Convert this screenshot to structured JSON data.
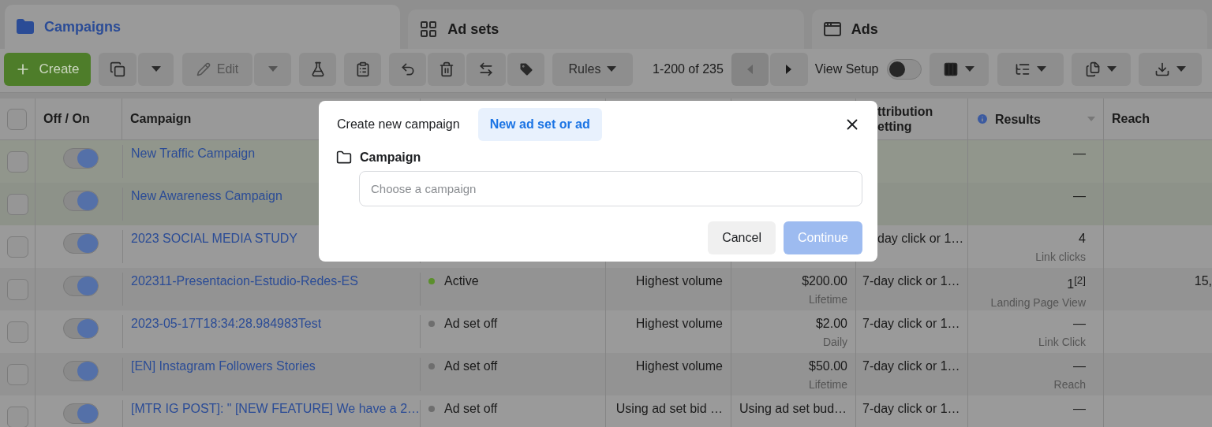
{
  "tabs": [
    {
      "label": "Campaigns",
      "selected": true
    },
    {
      "label": "Ad sets",
      "selected": false
    },
    {
      "label": "Ads",
      "selected": false
    }
  ],
  "toolbar": {
    "create": "Create",
    "edit": "Edit",
    "rules": "Rules",
    "pagination": "1-200 of 235",
    "view_setup": {
      "label": "View Setup",
      "on": false
    }
  },
  "table": {
    "select_all": {
      "checked": false
    },
    "columns": [
      "Off / On",
      "Campaign",
      "ttribution etting",
      "Results",
      "Reach"
    ],
    "rows": [
      {
        "checked": false,
        "on": true,
        "highlighted": true,
        "name": "New Traffic Campaign",
        "results": "—"
      },
      {
        "checked": false,
        "on": true,
        "highlighted": true,
        "name": "New Awareness Campaign",
        "results": "—"
      },
      {
        "checked": false,
        "on": true,
        "highlighted": false,
        "under_dialog": true,
        "name": "2023 SOCIAL MEDIA STUDY",
        "attribution": "day click or 1…",
        "results": "4",
        "result_type": "Link clicks"
      },
      {
        "checked": false,
        "on": true,
        "highlighted": false,
        "name": "202311-Presentacion-Estudio-Redes-ES",
        "delivery": {
          "label": "Active",
          "color": "#5b8f2c"
        },
        "bid": "Highest volume",
        "budget": "$200.00",
        "budget_period": "Lifetime",
        "attribution": "7-day click or 1…",
        "results": "1$^{[2]}$",
        "result_type": "Landing Page View",
        "reach": "15,"
      },
      {
        "checked": false,
        "on": true,
        "highlighted": false,
        "name": "2023-05-17T18:34:28.984983Test",
        "delivery": {
          "label": "Ad set off",
          "color": "#6e6e6e"
        },
        "bid": "Highest volume",
        "budget": "$2.00",
        "budget_period": "Daily",
        "attribution": "7-day click or 1…",
        "results": "—",
        "result_type": "Link Click"
      },
      {
        "checked": false,
        "on": true,
        "highlighted": false,
        "name": "[EN] Instagram Followers Stories",
        "delivery": {
          "label": "Ad set off",
          "color": "#6e6e6e"
        },
        "bid": "Highest volume",
        "budget": "$50.00",
        "budget_period": "Lifetime",
        "attribution": "7-day click or 1…",
        "results": "—",
        "result_type": "Reach"
      },
      {
        "checked": false,
        "on": true,
        "highlighted": false,
        "name": "[MTR IG POST]: \" [NEW FEATURE]  We have a 2…",
        "delivery": {
          "label": "Ad set off",
          "color": "#6e6e6e"
        },
        "bid": "Using ad set bid …",
        "budget": "Using ad set bud…",
        "attribution": "7-day click or 1…",
        "results": "—"
      }
    ]
  },
  "dialog": {
    "tabs": [
      {
        "label": "Create new campaign",
        "selected": false
      },
      {
        "label": "New ad set or ad",
        "selected": true
      }
    ],
    "field_label": "Campaign",
    "placeholder": "Choose a campaign",
    "buttons": [
      {
        "label": "Cancel",
        "kind": "secondary",
        "disabled": false
      },
      {
        "label": "Continue",
        "kind": "primary",
        "disabled": true
      }
    ]
  }
}
